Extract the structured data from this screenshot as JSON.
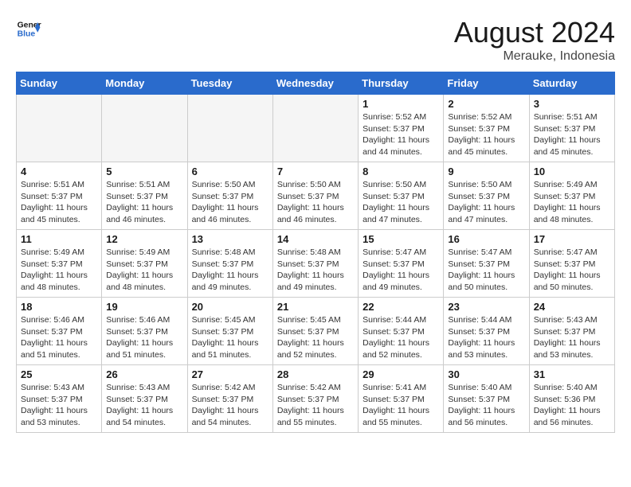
{
  "header": {
    "logo_line1": "General",
    "logo_line2": "Blue",
    "month_title": "August 2024",
    "location": "Merauke, Indonesia"
  },
  "weekdays": [
    "Sunday",
    "Monday",
    "Tuesday",
    "Wednesday",
    "Thursday",
    "Friday",
    "Saturday"
  ],
  "weeks": [
    [
      {
        "day": "",
        "empty": true
      },
      {
        "day": "",
        "empty": true
      },
      {
        "day": "",
        "empty": true
      },
      {
        "day": "",
        "empty": true
      },
      {
        "day": "1",
        "sunrise": "5:52 AM",
        "sunset": "5:37 PM",
        "daylight": "11 hours and 44 minutes."
      },
      {
        "day": "2",
        "sunrise": "5:52 AM",
        "sunset": "5:37 PM",
        "daylight": "11 hours and 45 minutes."
      },
      {
        "day": "3",
        "sunrise": "5:51 AM",
        "sunset": "5:37 PM",
        "daylight": "11 hours and 45 minutes."
      }
    ],
    [
      {
        "day": "4",
        "sunrise": "5:51 AM",
        "sunset": "5:37 PM",
        "daylight": "11 hours and 45 minutes."
      },
      {
        "day": "5",
        "sunrise": "5:51 AM",
        "sunset": "5:37 PM",
        "daylight": "11 hours and 46 minutes."
      },
      {
        "day": "6",
        "sunrise": "5:50 AM",
        "sunset": "5:37 PM",
        "daylight": "11 hours and 46 minutes."
      },
      {
        "day": "7",
        "sunrise": "5:50 AM",
        "sunset": "5:37 PM",
        "daylight": "11 hours and 46 minutes."
      },
      {
        "day": "8",
        "sunrise": "5:50 AM",
        "sunset": "5:37 PM",
        "daylight": "11 hours and 47 minutes."
      },
      {
        "day": "9",
        "sunrise": "5:50 AM",
        "sunset": "5:37 PM",
        "daylight": "11 hours and 47 minutes."
      },
      {
        "day": "10",
        "sunrise": "5:49 AM",
        "sunset": "5:37 PM",
        "daylight": "11 hours and 48 minutes."
      }
    ],
    [
      {
        "day": "11",
        "sunrise": "5:49 AM",
        "sunset": "5:37 PM",
        "daylight": "11 hours and 48 minutes."
      },
      {
        "day": "12",
        "sunrise": "5:49 AM",
        "sunset": "5:37 PM",
        "daylight": "11 hours and 48 minutes."
      },
      {
        "day": "13",
        "sunrise": "5:48 AM",
        "sunset": "5:37 PM",
        "daylight": "11 hours and 49 minutes."
      },
      {
        "day": "14",
        "sunrise": "5:48 AM",
        "sunset": "5:37 PM",
        "daylight": "11 hours and 49 minutes."
      },
      {
        "day": "15",
        "sunrise": "5:47 AM",
        "sunset": "5:37 PM",
        "daylight": "11 hours and 49 minutes."
      },
      {
        "day": "16",
        "sunrise": "5:47 AM",
        "sunset": "5:37 PM",
        "daylight": "11 hours and 50 minutes."
      },
      {
        "day": "17",
        "sunrise": "5:47 AM",
        "sunset": "5:37 PM",
        "daylight": "11 hours and 50 minutes."
      }
    ],
    [
      {
        "day": "18",
        "sunrise": "5:46 AM",
        "sunset": "5:37 PM",
        "daylight": "11 hours and 51 minutes."
      },
      {
        "day": "19",
        "sunrise": "5:46 AM",
        "sunset": "5:37 PM",
        "daylight": "11 hours and 51 minutes."
      },
      {
        "day": "20",
        "sunrise": "5:45 AM",
        "sunset": "5:37 PM",
        "daylight": "11 hours and 51 minutes."
      },
      {
        "day": "21",
        "sunrise": "5:45 AM",
        "sunset": "5:37 PM",
        "daylight": "11 hours and 52 minutes."
      },
      {
        "day": "22",
        "sunrise": "5:44 AM",
        "sunset": "5:37 PM",
        "daylight": "11 hours and 52 minutes."
      },
      {
        "day": "23",
        "sunrise": "5:44 AM",
        "sunset": "5:37 PM",
        "daylight": "11 hours and 53 minutes."
      },
      {
        "day": "24",
        "sunrise": "5:43 AM",
        "sunset": "5:37 PM",
        "daylight": "11 hours and 53 minutes."
      }
    ],
    [
      {
        "day": "25",
        "sunrise": "5:43 AM",
        "sunset": "5:37 PM",
        "daylight": "11 hours and 53 minutes."
      },
      {
        "day": "26",
        "sunrise": "5:43 AM",
        "sunset": "5:37 PM",
        "daylight": "11 hours and 54 minutes."
      },
      {
        "day": "27",
        "sunrise": "5:42 AM",
        "sunset": "5:37 PM",
        "daylight": "11 hours and 54 minutes."
      },
      {
        "day": "28",
        "sunrise": "5:42 AM",
        "sunset": "5:37 PM",
        "daylight": "11 hours and 55 minutes."
      },
      {
        "day": "29",
        "sunrise": "5:41 AM",
        "sunset": "5:37 PM",
        "daylight": "11 hours and 55 minutes."
      },
      {
        "day": "30",
        "sunrise": "5:40 AM",
        "sunset": "5:37 PM",
        "daylight": "11 hours and 56 minutes."
      },
      {
        "day": "31",
        "sunrise": "5:40 AM",
        "sunset": "5:36 PM",
        "daylight": "11 hours and 56 minutes."
      }
    ]
  ]
}
